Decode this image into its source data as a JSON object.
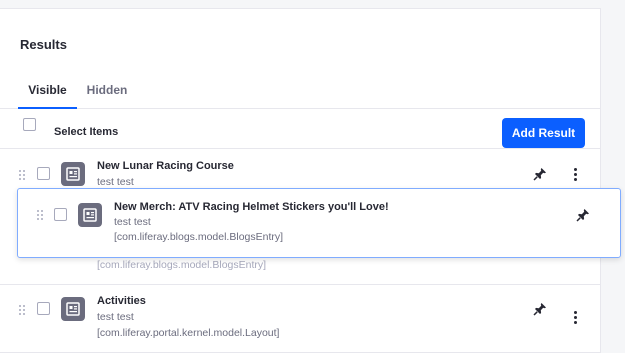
{
  "panel": {
    "title": "Results"
  },
  "tabs": [
    {
      "label": "Visible",
      "active": true
    },
    {
      "label": "Hidden",
      "active": false
    }
  ],
  "toolbar": {
    "select_label": "Select Items",
    "add_button": "Add Result"
  },
  "results": [
    {
      "title": "New Lunar Racing Course",
      "subtitle": "test test",
      "type": "",
      "icon": "document-icon",
      "pinned": true
    },
    {
      "title": "",
      "subtitle": "",
      "type": "[com.liferay.blogs.model.BlogsEntry]",
      "icon": "document-icon",
      "pinned": true
    },
    {
      "title": "Activities",
      "subtitle": "test test",
      "type": "[com.liferay.portal.kernel.model.Layout]",
      "icon": "document-icon",
      "pinned": true
    }
  ],
  "dragging": {
    "title": "New Merch: ATV Racing Helmet Stickers you'll Love!",
    "subtitle": "test test",
    "type": "[com.liferay.blogs.model.BlogsEntry]",
    "icon": "document-icon",
    "pinned": true
  },
  "colors": {
    "primary": "#0b5fff",
    "icon_bg": "#6b6c7e",
    "drag_border": "#80acff"
  }
}
